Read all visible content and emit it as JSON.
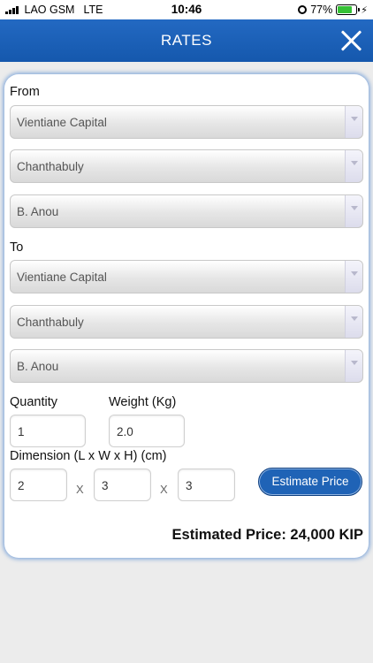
{
  "status_bar": {
    "carrier": "LAO GSM",
    "network": "LTE",
    "time": "10:46",
    "battery_percent": "77%",
    "battery_level": 0.77
  },
  "header": {
    "title": "RATES",
    "color": "#1a5fb4"
  },
  "form": {
    "from_label": "From",
    "from": {
      "province": "Vientiane Capital",
      "district": "Chanthabuly",
      "village": "B. Anou"
    },
    "to_label": "To",
    "to": {
      "province": "Vientiane Capital",
      "district": "Chanthabuly",
      "village": "B. Anou"
    },
    "quantity_label": "Quantity",
    "quantity_value": "1",
    "weight_label": "Weight (Kg)",
    "weight_value": "2.0",
    "dimension_label": "Dimension (L x W x H) (cm)",
    "length_value": "2",
    "width_value": "3",
    "height_value": "3",
    "times_symbol": "X",
    "estimate_button": "Estimate Price",
    "estimated_price": "Estimated Price: 24,000 KIP"
  },
  "icons": [
    "signal-icon",
    "alarm-icon",
    "battery-icon",
    "charging-icon",
    "close-icon",
    "chevron-down-icon"
  ]
}
